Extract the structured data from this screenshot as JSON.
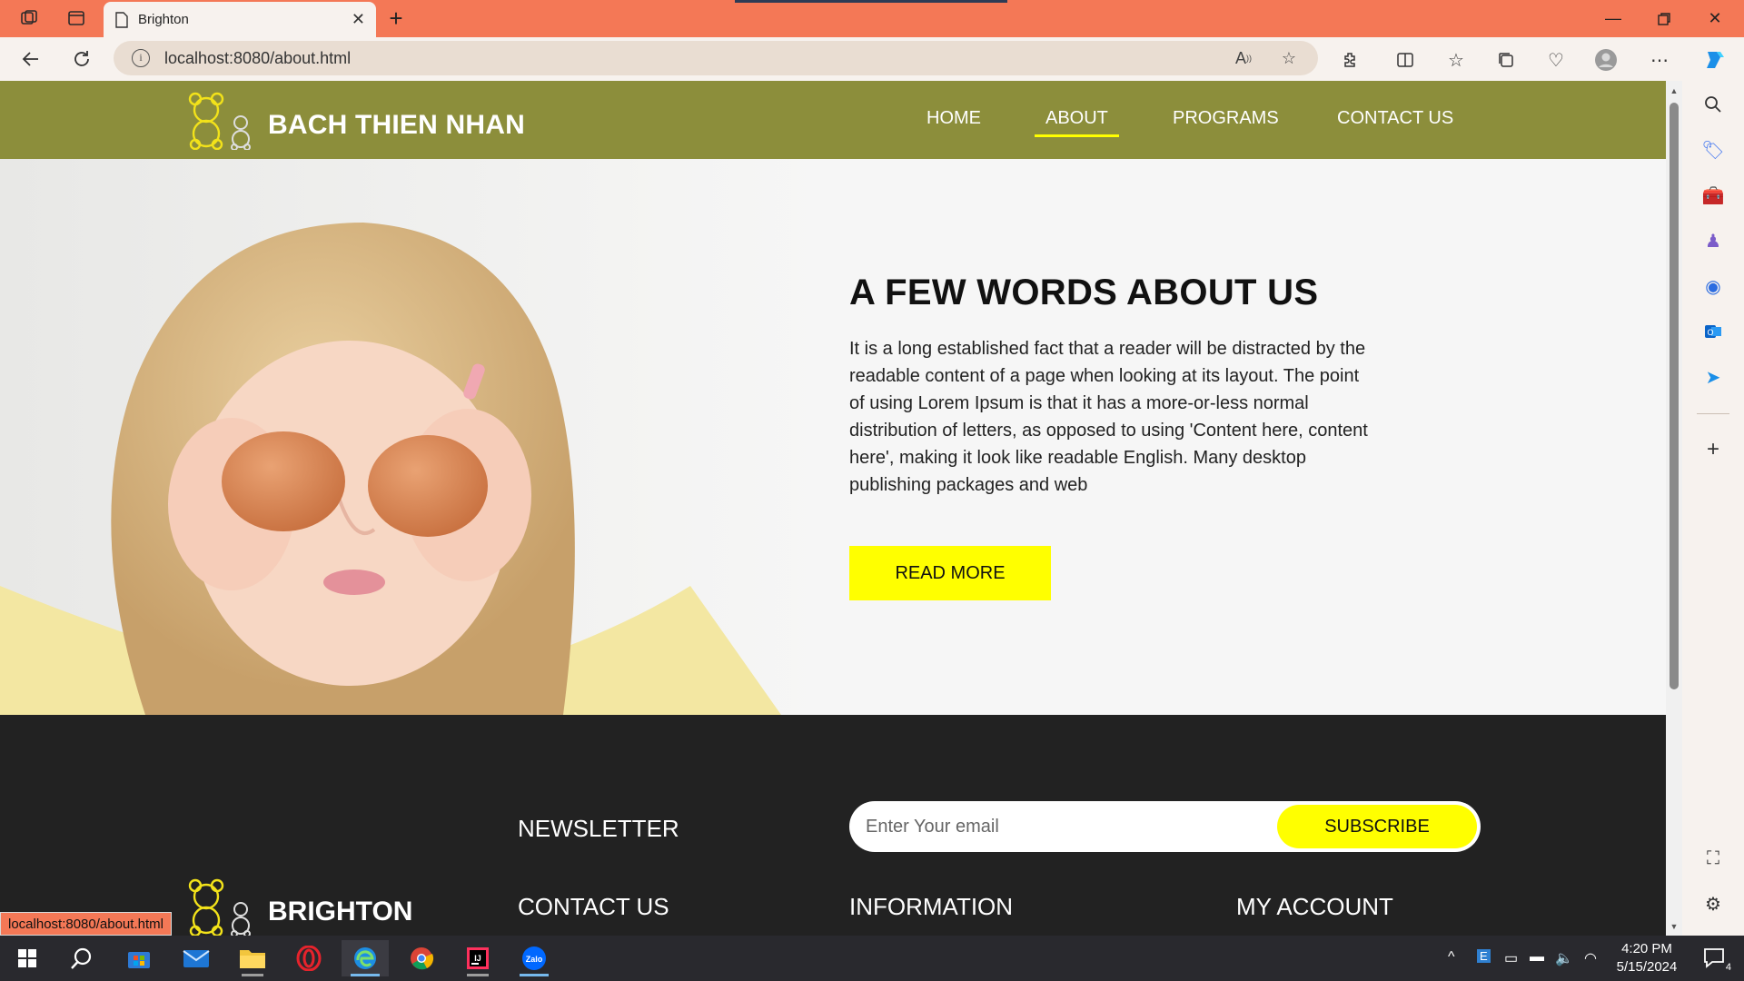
{
  "browser": {
    "tab_title": "Brighton",
    "url": "localhost:8080/about.html",
    "status_url": "localhost:8080/about.html"
  },
  "site": {
    "logo_text": "BACH THIEN NHAN",
    "nav": [
      {
        "label": "HOME"
      },
      {
        "label": "ABOUT"
      },
      {
        "label": "PROGRAMS"
      },
      {
        "label": "CONTACT US"
      }
    ],
    "hero": {
      "title": "A FEW WORDS ABOUT US",
      "body": "It is a long established fact that a reader will be distracted by the readable content of a page when looking at its layout. The point of using Lorem Ipsum is that it has a more-or-less normal distribution of letters, as opposed to using 'Content here, content here', making it look like readable English. Many desktop publishing packages and web",
      "button": "READ MORE"
    },
    "footer": {
      "newsletter": "NEWSLETTER",
      "email_placeholder": "Enter Your email",
      "subscribe": "SUBSCRIBE",
      "logo_text": "BRIGHTON",
      "contact": "CONTACT US",
      "information": "INFORMATION",
      "account": "MY ACCOUNT"
    }
  },
  "taskbar": {
    "time": "4:20 PM",
    "date": "5/15/2024",
    "notifications": "4"
  },
  "colors": {
    "titlebar": "#f47856",
    "header": "#8c8e3b",
    "accent": "#ffff00",
    "footer": "#222222"
  }
}
